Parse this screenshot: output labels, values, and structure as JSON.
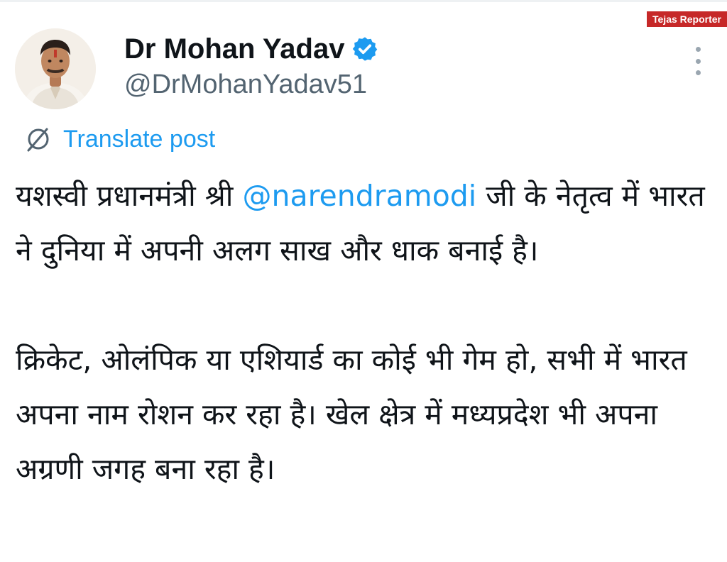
{
  "watermark": "Tejas Reporter",
  "author": {
    "name": "Dr Mohan Yadav",
    "handle": "@DrMohanYadav51",
    "avatar_icon": "person-avatar",
    "verified_icon": "verified-badge-icon",
    "verified_color": "#1d9bf0"
  },
  "actions": {
    "more_icon": "more-options-icon"
  },
  "translate": {
    "label": "Translate post",
    "icon": "translate-globe-icon"
  },
  "post": {
    "para1_prefix": "यशस्वी प्रधानमंत्री श्री ",
    "mention": "@narendramodi",
    "para1_suffix": " जी के नेतृत्व में भारत ने दुनिया में अपनी अलग साख और धाक बनाई है।",
    "para2": "क्रिकेट, ओलंपिक या एशियार्ड का कोई भी गेम हो, सभी में भारत अपना नाम रोशन कर रहा है। खेल क्षेत्र में मध्यप्रदेश भी अपना अग्रणी जगह बना रहा है।"
  },
  "colors": {
    "link": "#1d9bf0",
    "text": "#0f1419",
    "muted": "#536471",
    "watermark_bg": "#c62828"
  }
}
